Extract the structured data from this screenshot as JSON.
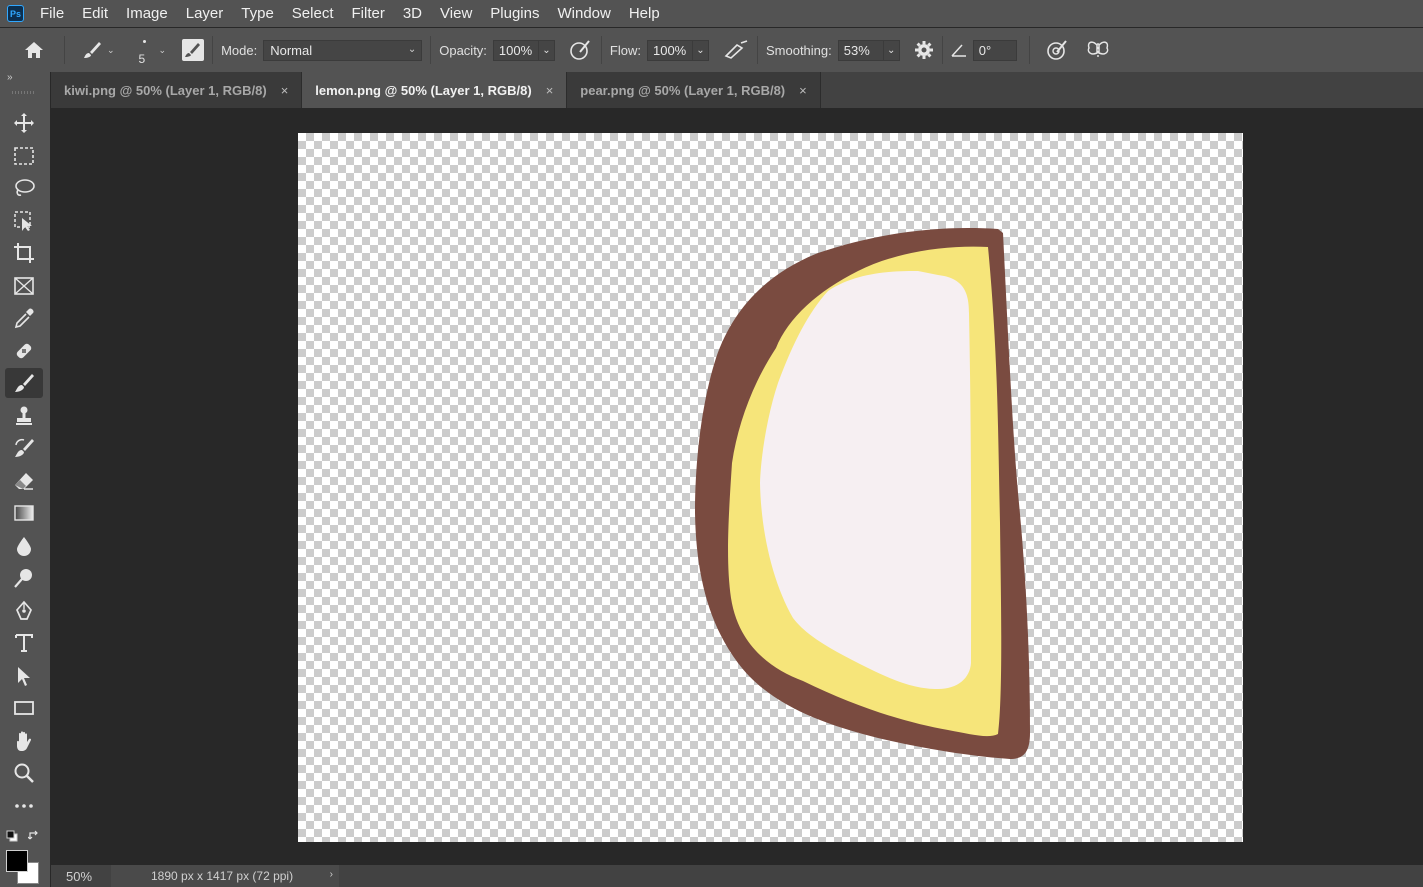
{
  "app": {
    "logo": "Ps",
    "menu": [
      "File",
      "Edit",
      "Image",
      "Layer",
      "Type",
      "Select",
      "Filter",
      "3D",
      "View",
      "Plugins",
      "Window",
      "Help"
    ]
  },
  "options": {
    "brush_size": "5",
    "mode_label": "Mode:",
    "mode_value": "Normal",
    "opacity_label": "Opacity:",
    "opacity_value": "100%",
    "flow_label": "Flow:",
    "flow_value": "100%",
    "smoothing_label": "Smoothing:",
    "smoothing_value": "53%",
    "angle_value": "0°"
  },
  "tabs": [
    {
      "label": "kiwi.png @ 50% (Layer 1, RGB/8)",
      "active": false
    },
    {
      "label": "lemon.png @ 50% (Layer 1, RGB/8)",
      "active": true
    },
    {
      "label": "pear.png @ 50% (Layer 1, RGB/8)",
      "active": false
    }
  ],
  "tools": [
    "move-tool",
    "marquee-tool",
    "lasso-tool",
    "object-selection-tool",
    "crop-tool",
    "frame-tool",
    "eyedropper-tool",
    "healing-brush-tool",
    "brush-tool",
    "clone-stamp-tool",
    "history-brush-tool",
    "eraser-tool",
    "gradient-tool",
    "blur-tool",
    "dodge-tool",
    "pen-tool",
    "type-tool",
    "path-selection-tool",
    "rectangle-tool",
    "hand-tool",
    "zoom-tool",
    "more-tools"
  ],
  "colors": {
    "foreground": "#000000",
    "background": "#ffffff",
    "lemon_rind": "#7a4b40",
    "lemon_peel": "#f6e57a",
    "lemon_flesh": "#f6eff2"
  },
  "status": {
    "zoom": "50%",
    "doc_info": "1890 px x 1417 px (72 ppi)",
    "more": "›"
  },
  "misc": {
    "close_symbol": "×",
    "collapse_symbol": "»"
  }
}
